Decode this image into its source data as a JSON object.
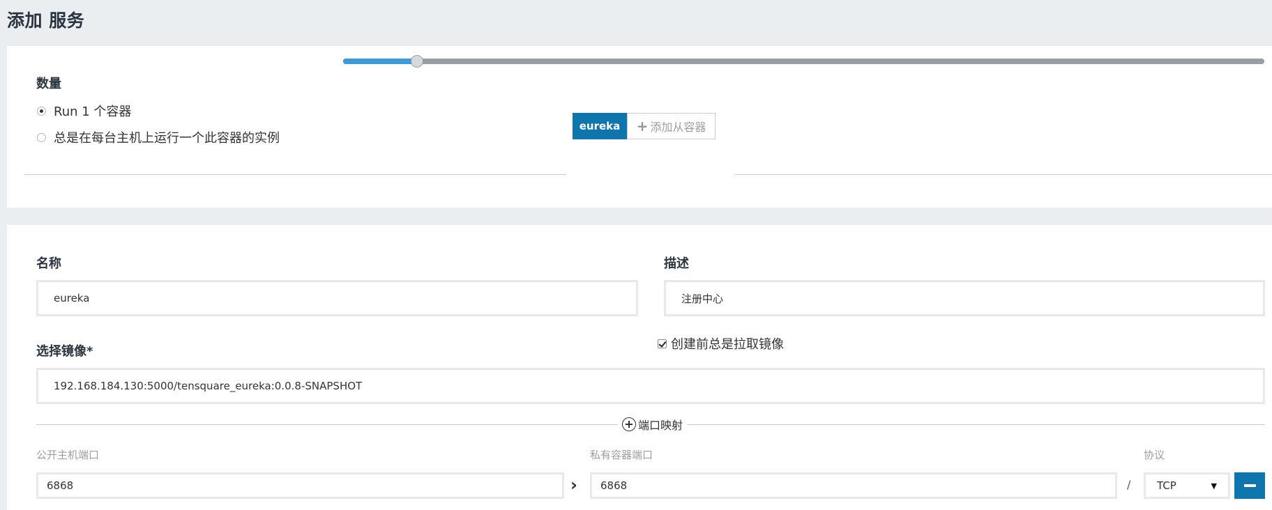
{
  "page": {
    "title": "添加 服务"
  },
  "scale": {
    "label": "数量",
    "options": [
      {
        "label": "Run 1 个容器",
        "selected": true
      },
      {
        "label": "总是在每台主机上运行一个此容器的实例",
        "selected": false
      }
    ],
    "slider_value": 1,
    "slider_fraction": 0.08
  },
  "containers": {
    "tabs": [
      {
        "label": "eureka",
        "active": true
      }
    ],
    "add_sidekick_label": "添加从容器"
  },
  "form": {
    "name": {
      "label": "名称",
      "value": "eureka"
    },
    "description": {
      "label": "描述",
      "value": "注册中心"
    },
    "image": {
      "label": "选择镜像*",
      "value": "192.168.184.130:5000/tensquare_eureka:0.0.8-SNAPSHOT"
    },
    "always_pull": {
      "label": "创建前总是拉取镜像",
      "checked": true
    }
  },
  "ports": {
    "toggle_label": "端口映射",
    "public_label": "公开主机端口",
    "private_label": "私有容器端口",
    "protocol_label": "协议",
    "separator": "/",
    "rows": [
      {
        "public": "6868",
        "private": "6868",
        "protocol": "TCP"
      }
    ]
  },
  "colors": {
    "accent": "#0f76ad",
    "slider_fill": "#3d9bd9",
    "background": "#eaeef0"
  }
}
